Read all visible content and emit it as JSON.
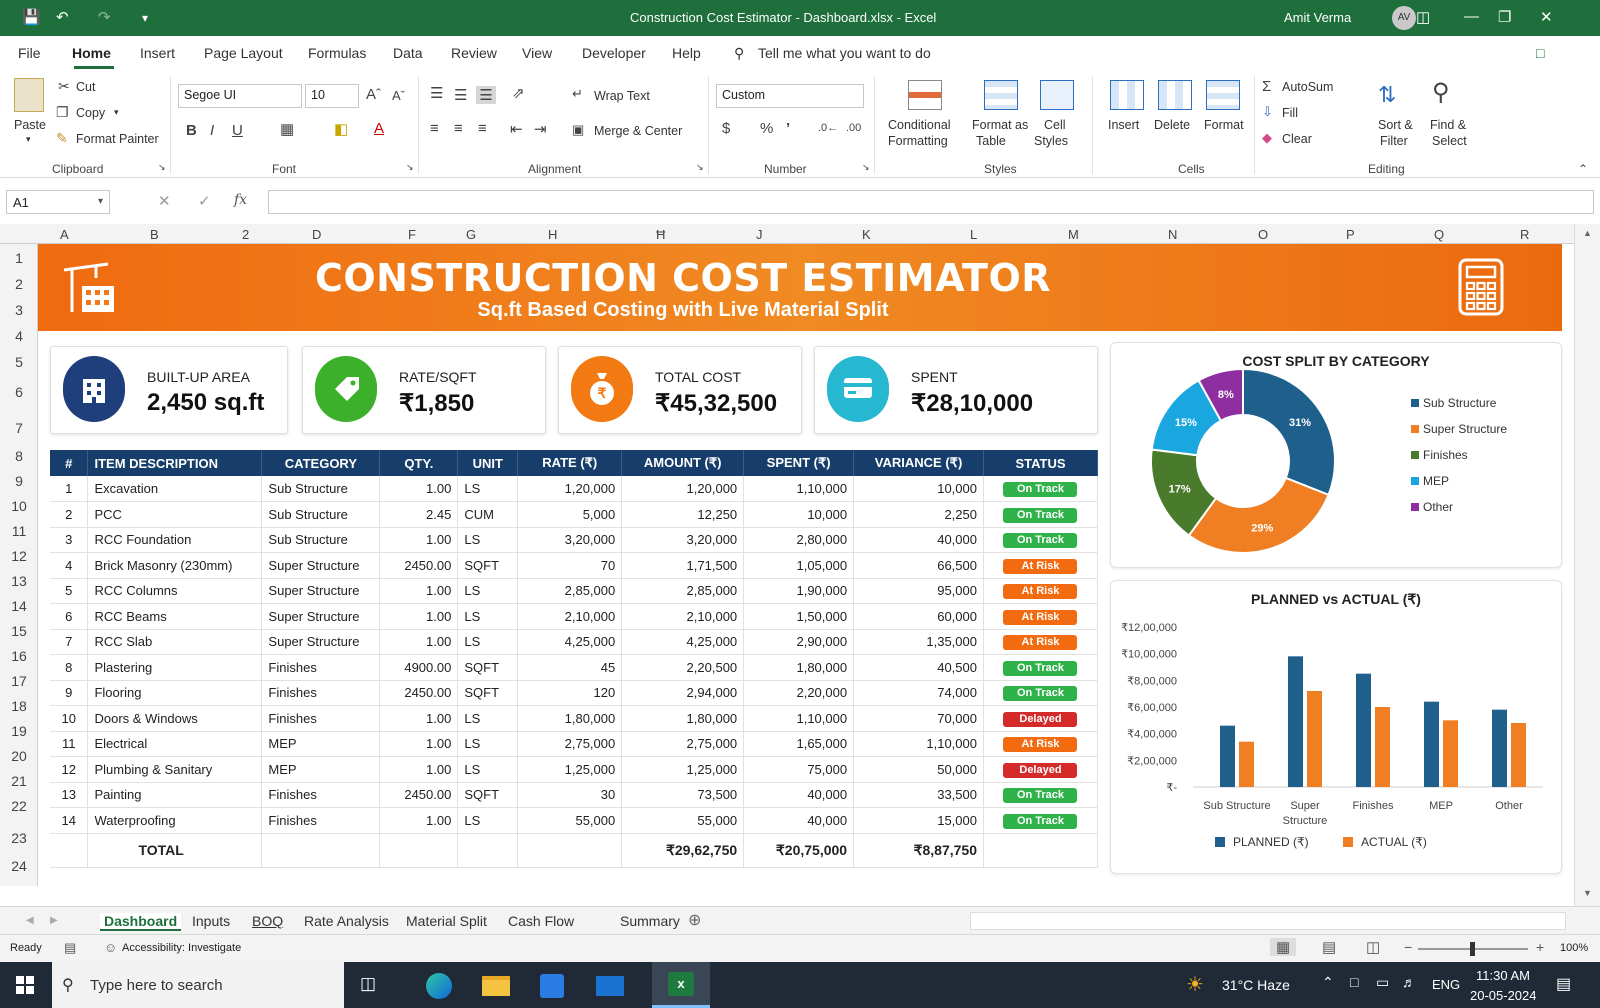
{
  "window": {
    "title": "Construction Cost Estimator - Dashboard.xlsx  -  Excel",
    "user": "Amit Verma",
    "avatar": "AV"
  },
  "menu": [
    "File",
    "Home",
    "Insert",
    "Page Layout",
    "Formulas",
    "Data",
    "Review",
    "View",
    "Developer",
    "Help"
  ],
  "tell_me": "Tell me what you want to do",
  "ribbon": {
    "paste": "Paste",
    "cut": "Cut",
    "copy": "Copy",
    "format_painter": "Format Painter",
    "clipboard": "Clipboard",
    "font_name": "Segoe UI",
    "font_size": "10",
    "font": "Font",
    "wrap_text": "Wrap Text",
    "merge_center": "Merge & Center",
    "alignment": "Alignment",
    "number_format": "Custom",
    "number": "Number",
    "cond_fmt_1": "Conditional",
    "cond_fmt_2": "Formatting",
    "fmt_table_1": "Format as",
    "fmt_table_2": "Table",
    "cell_styles_1": "Cell",
    "cell_styles_2": "Styles",
    "styles": "Styles",
    "insert": "Insert",
    "delete": "Delete",
    "format": "Format",
    "cells": "Cells",
    "autosum": "AutoSum",
    "fill": "Fill",
    "clear": "Clear",
    "sort_1": "Sort &",
    "sort_2": "Filter",
    "find_1": "Find &",
    "find_2": "Select",
    "editing": "Editing"
  },
  "formula_bar": {
    "name_box": "A1",
    "fx": "fx",
    "formula": ""
  },
  "columns": [
    "A",
    "B",
    "2",
    "D",
    "F",
    "G",
    "H",
    "Ħ",
    "J",
    "K",
    "L",
    "M",
    "N",
    "O",
    "P",
    "Q",
    "R"
  ],
  "rows": [
    "1",
    "2",
    "3",
    "4",
    "5",
    "6",
    "7",
    "8",
    "9",
    "10",
    "11",
    "12",
    "13",
    "14",
    "15",
    "16",
    "17",
    "18",
    "19",
    "20",
    "21",
    "22",
    "23",
    "24"
  ],
  "banner": {
    "title": "CONSTRUCTION COST ESTIMATOR",
    "subtitle": "Sq.ft Based Costing with Live Material Split"
  },
  "kpis": [
    {
      "label": "BUILT-UP AREA",
      "value": "2,450 sq.ft",
      "color": "#1e3f7c"
    },
    {
      "label": "RATE/SQFT",
      "value": "₹1,850",
      "color": "#3cb02b"
    },
    {
      "label": "TOTAL COST",
      "value": "₹45,32,500",
      "color": "#f37a12"
    },
    {
      "label": "SPENT",
      "value": "₹28,10,000",
      "color": "#27b8d1"
    }
  ],
  "table": {
    "headers": [
      "#",
      "ITEM DESCRIPTION",
      "CATEGORY",
      "QTY.",
      "UNIT",
      "RATE (₹)",
      "AMOUNT (₹)",
      "SPENT (₹)",
      "VARIANCE (₹)",
      "STATUS"
    ],
    "rows": [
      [
        "1",
        "Excavation",
        "Sub Structure",
        "1.00",
        "LS",
        "1,20,000",
        "1,20,000",
        "1,10,000",
        "10,000",
        "On Track"
      ],
      [
        "2",
        "PCC",
        "Sub Structure",
        "2.45",
        "CUM",
        "5,000",
        "12,250",
        "10,000",
        "2,250",
        "On Track"
      ],
      [
        "3",
        "RCC Foundation",
        "Sub Structure",
        "1.00",
        "LS",
        "3,20,000",
        "3,20,000",
        "2,80,000",
        "40,000",
        "On Track"
      ],
      [
        "4",
        "Brick Masonry (230mm)",
        "Super Structure",
        "2450.00",
        "SQFT",
        "70",
        "1,71,500",
        "1,05,000",
        "66,500",
        "At Risk"
      ],
      [
        "5",
        "RCC Columns",
        "Super Structure",
        "1.00",
        "LS",
        "2,85,000",
        "2,85,000",
        "1,90,000",
        "95,000",
        "At Risk"
      ],
      [
        "6",
        "RCC Beams",
        "Super Structure",
        "1.00",
        "LS",
        "2,10,000",
        "2,10,000",
        "1,50,000",
        "60,000",
        "At Risk"
      ],
      [
        "7",
        "RCC Slab",
        "Super Structure",
        "1.00",
        "LS",
        "4,25,000",
        "4,25,000",
        "2,90,000",
        "1,35,000",
        "At Risk"
      ],
      [
        "8",
        "Plastering",
        "Finishes",
        "4900.00",
        "SQFT",
        "45",
        "2,20,500",
        "1,80,000",
        "40,500",
        "On Track"
      ],
      [
        "9",
        "Flooring",
        "Finishes",
        "2450.00",
        "SQFT",
        "120",
        "2,94,000",
        "2,20,000",
        "74,000",
        "On Track"
      ],
      [
        "10",
        "Doors & Windows",
        "Finishes",
        "1.00",
        "LS",
        "1,80,000",
        "1,80,000",
        "1,10,000",
        "70,000",
        "Delayed"
      ],
      [
        "11",
        "Electrical",
        "MEP",
        "1.00",
        "LS",
        "2,75,000",
        "2,75,000",
        "1,65,000",
        "1,10,000",
        "At Risk"
      ],
      [
        "12",
        "Plumbing & Sanitary",
        "MEP",
        "1.00",
        "LS",
        "1,25,000",
        "1,25,000",
        "75,000",
        "50,000",
        "Delayed"
      ],
      [
        "13",
        "Painting",
        "Finishes",
        "2450.00",
        "SQFT",
        "30",
        "73,500",
        "40,000",
        "33,500",
        "On Track"
      ],
      [
        "14",
        "Waterproofing",
        "Finishes",
        "1.00",
        "LS",
        "55,000",
        "55,000",
        "40,000",
        "15,000",
        "On Track"
      ]
    ],
    "total_label": "TOTAL",
    "total_amount": "₹29,62,750",
    "total_spent": "₹20,75,000",
    "total_variance": "₹8,87,750"
  },
  "chart_data": [
    {
      "type": "pie",
      "title": "COST SPLIT BY CATEGORY",
      "categories": [
        "Sub Structure",
        "Super Structure",
        "Finishes",
        "MEP",
        "Other"
      ],
      "values": [
        31,
        29,
        17,
        15,
        8
      ],
      "labels": [
        "31%",
        "29%",
        "17%",
        "15%",
        "8%"
      ],
      "colors": [
        "#1f5f8b",
        "#f07f23",
        "#4a7a2c",
        "#1aa7e0",
        "#8f2ea0"
      ],
      "legend": "right"
    },
    {
      "type": "bar",
      "title": "PLANNED vs ACTUAL (₹)",
      "categories": [
        "Sub Structure",
        "Super Structure",
        "Finishes",
        "MEP",
        "Other"
      ],
      "series": [
        {
          "name": "PLANNED (₹)",
          "values": [
            460000,
            980000,
            850000,
            640000,
            580000
          ],
          "color": "#1f5f8b"
        },
        {
          "name": "ACTUAL (₹)",
          "values": [
            340000,
            720000,
            600000,
            500000,
            480000
          ],
          "color": "#f07f23"
        }
      ],
      "ylim": [
        0,
        1200000
      ],
      "ytick_labels": [
        "₹12,00,000",
        "₹10,00,000",
        "₹8,00,000",
        "₹6,00,000",
        "₹4,00,000",
        "₹2,00,000",
        "₹-"
      ],
      "legend": "bottom"
    }
  ],
  "sheet_tabs": [
    "Dashboard",
    "Inputs",
    "BOQ",
    "Rate Analysis",
    "Material Split",
    "Cash Flow",
    "Summary"
  ],
  "status": {
    "ready": "Ready",
    "accessibility": "Accessibility: Investigate",
    "zoom": "100%"
  },
  "taskbar": {
    "search": "Type here to search",
    "weather": "31°C  Haze",
    "lang": "ENG",
    "time": "11:30 AM",
    "date": "20-05-2024"
  }
}
